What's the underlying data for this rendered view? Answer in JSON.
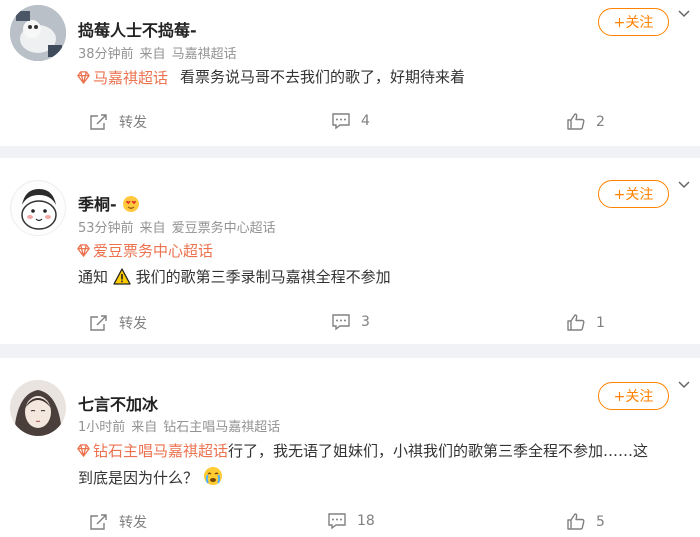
{
  "comments": [
    {
      "username": "捣莓人士不捣莓-",
      "time": "38分钟前",
      "from": "来自",
      "source": "马嘉祺超话",
      "topic": "马嘉祺超话",
      "text": "看票务说马哥不去我们的歌了，好期待来着",
      "follow_label": "+关注",
      "repost_label": "转发",
      "comment_count": "4",
      "like_count": "2"
    },
    {
      "username": "季桐-",
      "time": "53分钟前",
      "from": "来自",
      "source": "爱豆票务中心超话",
      "topic": "爱豆票务中心超话",
      "text_prefix": "通知",
      "text": "我们的歌第三季录制马嘉祺全程不参加",
      "follow_label": "+关注",
      "repost_label": "转发",
      "comment_count": "3",
      "like_count": "1"
    },
    {
      "username": "七言不加冰",
      "time": "1小时前",
      "from": "来自",
      "source": "钻石主唱马嘉祺超话",
      "topic": "钻石主唱马嘉祺超话",
      "text_line1": "行了，我无语了姐妹们，小祺我们的歌第三季全程不参加……这",
      "text_line2": "到底是因为什么？",
      "follow_label": "+关注",
      "repost_label": "转发",
      "comment_count": "18",
      "like_count": "5"
    }
  ],
  "colors": {
    "accent": "#ff8200",
    "topic": "#eb7350",
    "meta": "#939393",
    "background": "#f1f2f5"
  }
}
